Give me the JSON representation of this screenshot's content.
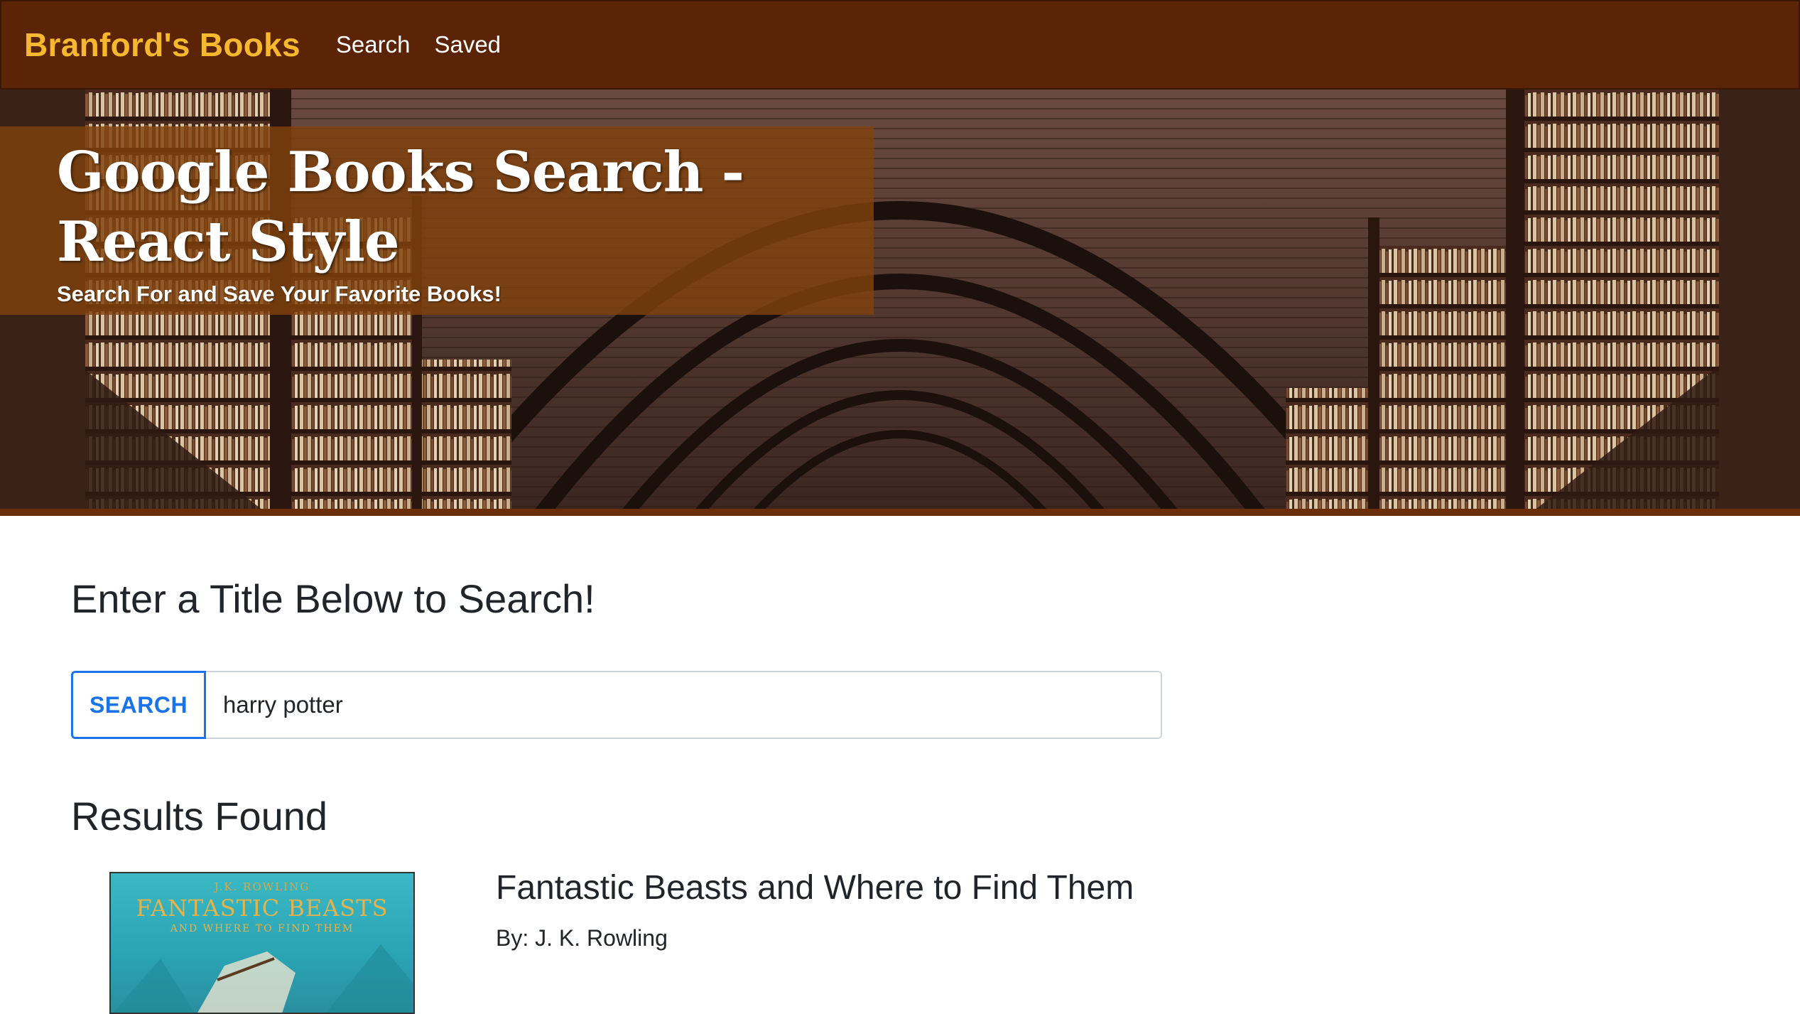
{
  "navbar": {
    "brand": "Branford's Books",
    "links": [
      "Search",
      "Saved"
    ]
  },
  "hero": {
    "title": "Google Books Search - React Style",
    "subtitle": "Search For and Save Your Favorite Books!"
  },
  "search": {
    "heading": "Enter a Title Below to Search!",
    "button_label": "SEARCH",
    "input_value": "harry potter"
  },
  "results": {
    "heading": "Results Found",
    "items": [
      {
        "title": "Fantastic Beasts and Where to Find Them",
        "author": "By: J. K. Rowling",
        "cover": {
          "author": "J.K. ROWLING",
          "title": "FANTASTIC BEASTS",
          "subtitle": "AND WHERE TO FIND THEM"
        }
      }
    ]
  },
  "colors": {
    "navbar_bg": "#5c2406",
    "brand": "#f5b82e",
    "hero_panel": "#80420e",
    "accent_blue": "#1a73e8"
  }
}
